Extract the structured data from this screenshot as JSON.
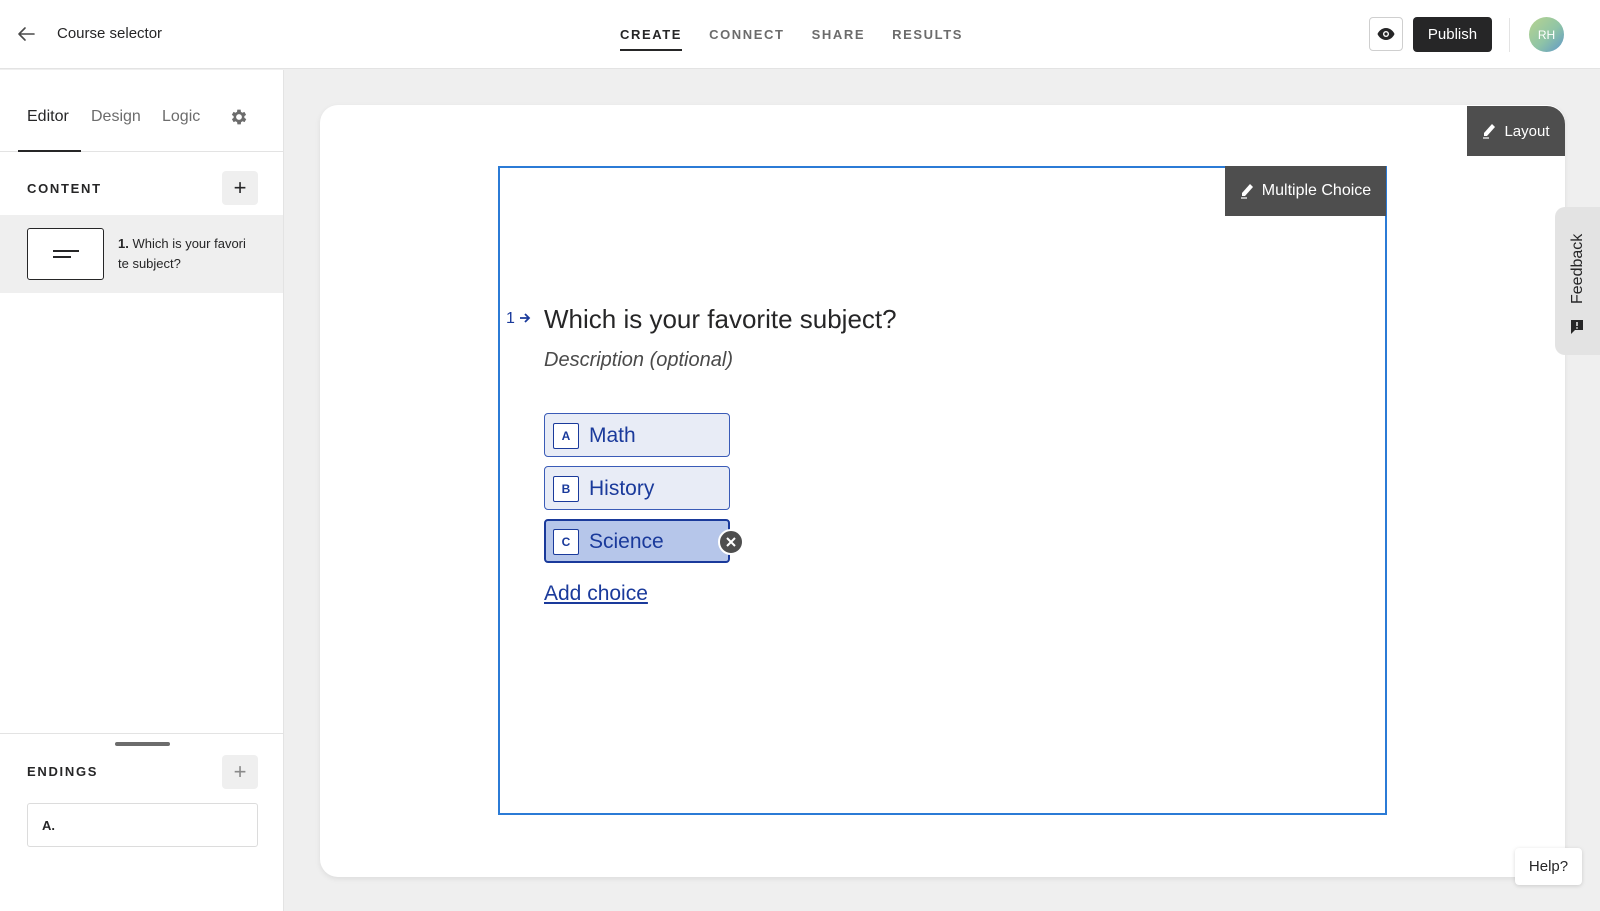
{
  "header": {
    "title": "Course selector",
    "nav_tabs": [
      {
        "label": "CREATE",
        "active": true
      },
      {
        "label": "CONNECT",
        "active": false
      },
      {
        "label": "SHARE",
        "active": false
      },
      {
        "label": "RESULTS",
        "active": false
      }
    ],
    "publish_label": "Publish",
    "avatar_initials": "RH"
  },
  "sidebar": {
    "tabs": [
      {
        "label": "Editor",
        "active": true
      },
      {
        "label": "Design",
        "active": false
      },
      {
        "label": "Logic",
        "active": false
      }
    ],
    "content_label": "CONTENT",
    "questions": [
      {
        "number": "1.",
        "text": "Which is your favorite subject?"
      }
    ],
    "endings_label": "ENDINGS",
    "endings": [
      {
        "label": "A."
      }
    ]
  },
  "canvas": {
    "layout_label": "Layout",
    "block_type_label": "Multiple Choice",
    "question_number": "1",
    "question_title": "Which is your favorite subject?",
    "description_placeholder": "Description (optional)",
    "choices": [
      {
        "key": "A",
        "label": "Math",
        "selected": false
      },
      {
        "key": "B",
        "label": "History",
        "selected": false
      },
      {
        "key": "C",
        "label": "Science",
        "selected": true
      }
    ],
    "add_choice_label": "Add choice"
  },
  "feedback_label": "Feedback",
  "help_label": "Help?",
  "colors": {
    "accent_blue": "#1a3a9b",
    "block_outline": "#2b7bd6",
    "dark": "#262627"
  },
  "icons": [
    "back-arrow-icon",
    "eye-icon",
    "gear-icon",
    "plus-icon",
    "pencil-icon",
    "close-icon",
    "feedback-icon"
  ]
}
